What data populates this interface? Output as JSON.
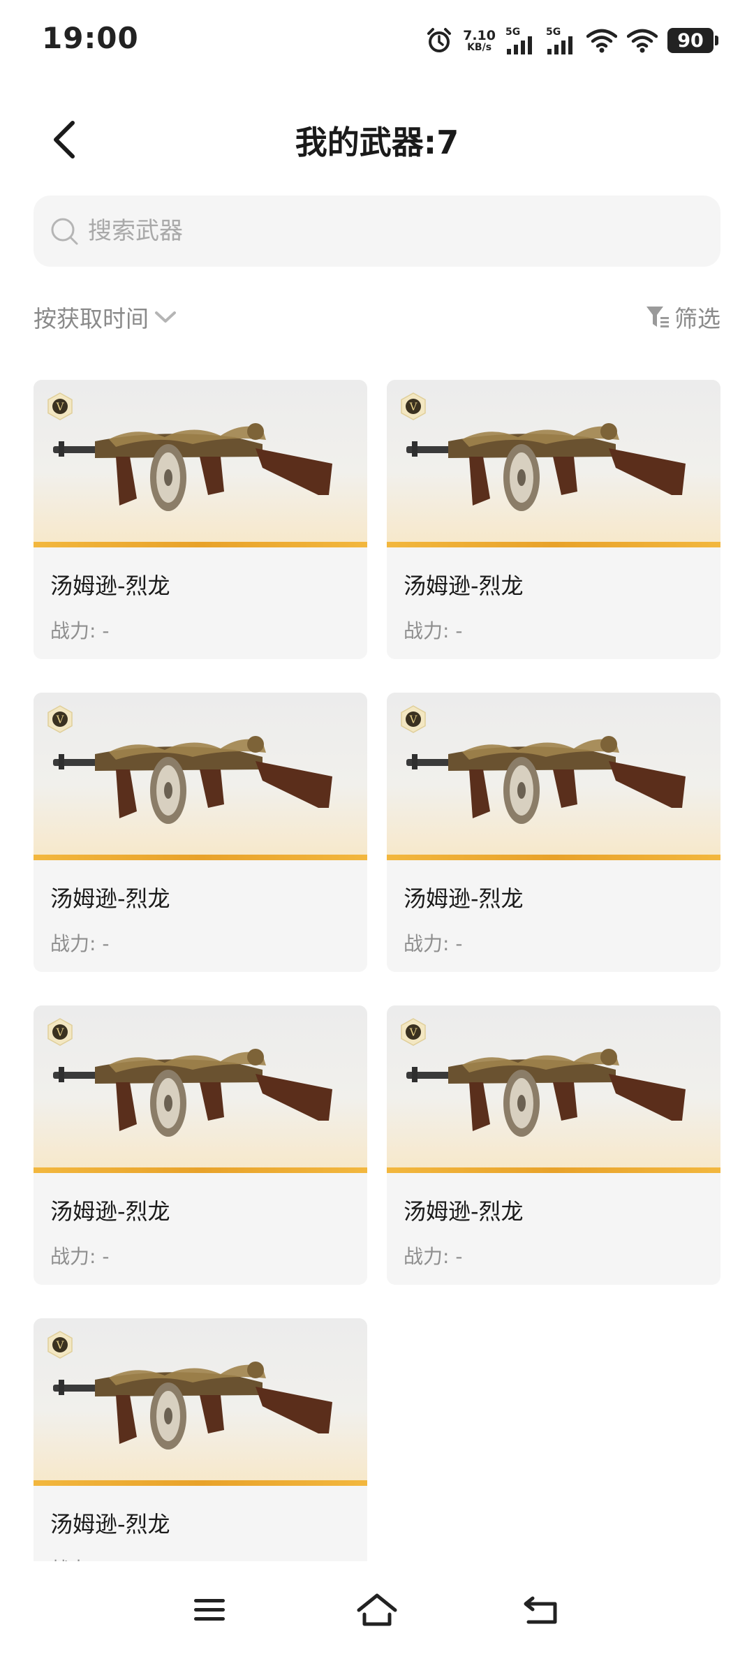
{
  "status_bar": {
    "time": "19:00",
    "net_speed_value": "7.10",
    "net_speed_unit": "KB/s",
    "signal1_label": "5G",
    "signal2_label": "5G",
    "battery": "90"
  },
  "header": {
    "title": "我的武器:7"
  },
  "search": {
    "placeholder": "搜索武器",
    "value": ""
  },
  "sort": {
    "label": "按获取时间"
  },
  "filter": {
    "label": "筛选"
  },
  "weapons": [
    {
      "name": "汤姆逊-烈龙",
      "power": "战力: -",
      "badge": "V"
    },
    {
      "name": "汤姆逊-烈龙",
      "power": "战力: -",
      "badge": "V"
    },
    {
      "name": "汤姆逊-烈龙",
      "power": "战力: -",
      "badge": "V"
    },
    {
      "name": "汤姆逊-烈龙",
      "power": "战力: -",
      "badge": "V"
    },
    {
      "name": "汤姆逊-烈龙",
      "power": "战力: -",
      "badge": "V"
    },
    {
      "name": "汤姆逊-烈龙",
      "power": "战力: -",
      "badge": "V"
    },
    {
      "name": "汤姆逊-烈龙",
      "power": "战力: -",
      "badge": "V"
    }
  ],
  "colors": {
    "accent_bar": "#e8a22a",
    "card_bg": "#f5f5f5",
    "muted_text": "#8a8a8a"
  },
  "icons": {
    "back": "chevron-left-icon",
    "search": "search-icon",
    "sort": "chevron-down-icon",
    "filter": "filter-icon",
    "nav_menu": "menu-icon",
    "nav_home": "home-icon",
    "nav_back": "back-arrow-icon"
  }
}
